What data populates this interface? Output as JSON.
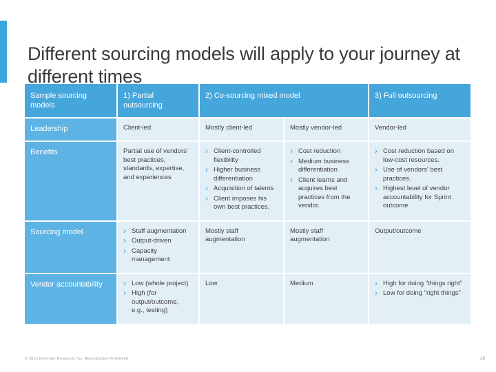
{
  "slide": {
    "title": "Different sourcing models will apply to your journey at different times",
    "footer_left": "© 2015 Forrester Research, Inc. Reproduction Prohibited",
    "footer_right": "16"
  },
  "table": {
    "headers": [
      "Sample sourcing models",
      "1) Partial outsourcing",
      "2) Co-sourcing mixed model",
      "",
      "3) Full outsourcing"
    ],
    "rows": [
      {
        "label": "Leadership",
        "cells": [
          {
            "type": "text",
            "text": "Client-led"
          },
          {
            "type": "text",
            "text": "Mostly client-led"
          },
          {
            "type": "text",
            "text": "Mostly vendor-led"
          },
          {
            "type": "text",
            "text": "Vendor-led"
          }
        ]
      },
      {
        "label": "Benefits",
        "cells": [
          {
            "type": "text",
            "text": "Partial use of vendors' best practices, standards, expertise, and experiences"
          },
          {
            "type": "list",
            "items": [
              "Client-controlled flexibility",
              "Higher business differentiation",
              "Acquisition of talents",
              "Client imposes his own best practices."
            ]
          },
          {
            "type": "list",
            "items": [
              "Cost reduction",
              "Medium business differentiation",
              "Client learns and acquires best practices from the vendor."
            ]
          },
          {
            "type": "list",
            "items": [
              "Cost reduction based on low-cost resources.",
              "Use of vendors' best practices.",
              "Highest level of vendor accountability for Sprint outcome"
            ]
          }
        ]
      },
      {
        "label": "Sourcing model",
        "cells": [
          {
            "type": "list",
            "items": [
              "Staff augmentation",
              "Output-driven",
              "Capacity management"
            ]
          },
          {
            "type": "text",
            "text": "Mostly staff augmentation"
          },
          {
            "type": "text",
            "text": "Mostly staff augmentation"
          },
          {
            "type": "text",
            "text": "Output/outcome"
          }
        ]
      },
      {
        "label": "Vendor accountability",
        "cells": [
          {
            "type": "list",
            "items": [
              "Low (whole project)",
              "High (for output/outcome, e.g., testing)"
            ]
          },
          {
            "type": "text",
            "text": "Low"
          },
          {
            "type": "text",
            "text": "Medium"
          },
          {
            "type": "list",
            "items": [
              "High for doing \"things right\"",
              "Low for doing \"right things\""
            ]
          }
        ]
      }
    ]
  },
  "colors": {
    "accent": "#3aa6dd",
    "header_bg": "#45a6dc",
    "rowlabel_bg": "#5cb3e4",
    "cell_bg": "#e3eff7"
  }
}
